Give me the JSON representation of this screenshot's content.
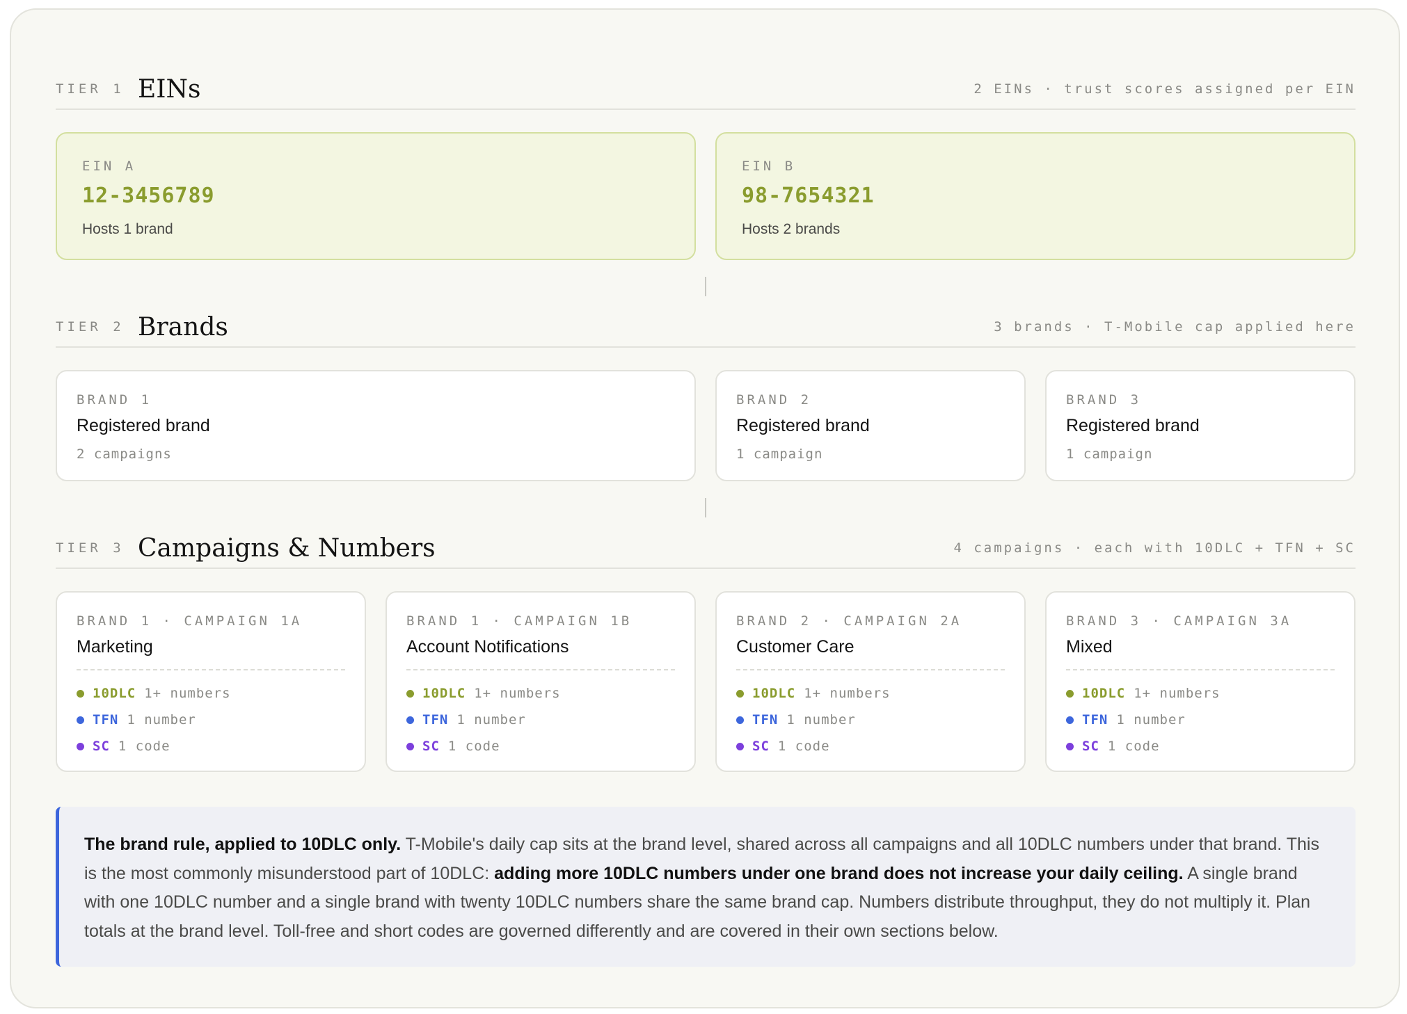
{
  "tiers": [
    {
      "label": "TIER 1",
      "title": "EINs",
      "meta": "2 EINs · trust scores assigned per EIN"
    },
    {
      "label": "TIER 2",
      "title": "Brands",
      "meta": "3 brands · T-Mobile cap applied here"
    },
    {
      "label": "TIER 3",
      "title": "Campaigns & Numbers",
      "meta": "4 campaigns · each with 10DLC + TFN + SC"
    }
  ],
  "eins": [
    {
      "key": "EIN A",
      "value": "12-3456789",
      "sub": "Hosts 1 brand"
    },
    {
      "key": "EIN B",
      "value": "98-7654321",
      "sub": "Hosts 2 brands"
    }
  ],
  "brands": [
    {
      "key": "BRAND 1",
      "title": "Registered brand",
      "sub": "2 campaigns"
    },
    {
      "key": "BRAND 2",
      "title": "Registered brand",
      "sub": "1 campaign"
    },
    {
      "key": "BRAND 3",
      "title": "Registered brand",
      "sub": "1 campaign"
    }
  ],
  "campaigns": [
    {
      "key": "BRAND 1 · CAMPAIGN 1A",
      "title": "Marketing",
      "rows": [
        {
          "tag": "10DLC",
          "note": "1+ numbers"
        },
        {
          "tag": "TFN",
          "note": "1 number"
        },
        {
          "tag": "SC",
          "note": "1 code"
        }
      ]
    },
    {
      "key": "BRAND 1 · CAMPAIGN 1B",
      "title": "Account Notifications",
      "rows": [
        {
          "tag": "10DLC",
          "note": "1+ numbers"
        },
        {
          "tag": "TFN",
          "note": "1 number"
        },
        {
          "tag": "SC",
          "note": "1 code"
        }
      ]
    },
    {
      "key": "BRAND 2 · CAMPAIGN 2A",
      "title": "Customer Care",
      "rows": [
        {
          "tag": "10DLC",
          "note": "1+ numbers"
        },
        {
          "tag": "TFN",
          "note": "1 number"
        },
        {
          "tag": "SC",
          "note": "1 code"
        }
      ]
    },
    {
      "key": "BRAND 3 · CAMPAIGN 3A",
      "title": "Mixed",
      "rows": [
        {
          "tag": "10DLC",
          "note": "1+ numbers"
        },
        {
          "tag": "TFN",
          "note": "1 number"
        },
        {
          "tag": "SC",
          "note": "1 code"
        }
      ]
    }
  ],
  "colors": {
    "tenDLC": "#8a9c2e",
    "tfn": "#3d66dc",
    "sc": "#7c3fdc",
    "callout_accent": "#3d66dc"
  },
  "callout": {
    "lead": "The brand rule, applied to 10DLC only.",
    "text1": " T-Mobile's daily cap sits at the brand level, shared across all campaigns and all 10DLC numbers under that brand. This is the most commonly misunderstood part of 10DLC: ",
    "emph": "adding more 10DLC numbers under one brand does not increase your daily ceiling.",
    "text2": " A single brand with one 10DLC number and a single brand with twenty 10DLC numbers share the same brand cap. Numbers distribute throughput, they do not multiply it. Plan totals at the brand level. Toll-free and short codes are governed differently and are covered in their own sections below."
  }
}
